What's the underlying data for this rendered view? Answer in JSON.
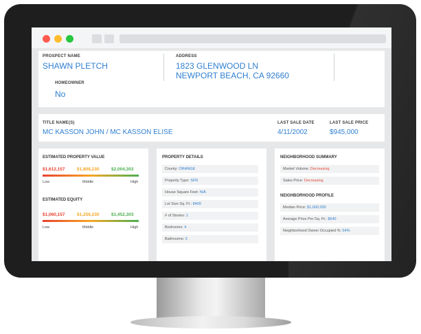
{
  "prospect": {
    "label": "PROSPECT NAME",
    "value": "SHAWN PLETCH"
  },
  "address": {
    "label": "ADDRESS",
    "line1": "1823 GLENWOOD LN",
    "line2": "NEWPORT BEACH, CA 92660"
  },
  "homeowner": {
    "label": "HOMEOWNER",
    "value": "No"
  },
  "title": {
    "label": "TITLE NAME(S)",
    "value": "MC KASSON JOHN / MC KASSON ELISE"
  },
  "last_sale_date": {
    "label": "LAST SALE DATE",
    "value": "4/11/2002"
  },
  "last_sale_price": {
    "label": "LAST SALE PRICE",
    "value": "$945,000"
  },
  "est_value": {
    "label": "ESTIMATED PROPERTY VALUE",
    "low": "$1,612,157",
    "mid": "$1,808,230",
    "high": "$2,004,303",
    "scale": [
      "Low",
      "Middle",
      "High"
    ]
  },
  "est_equity": {
    "label": "ESTIMATED EQUITY",
    "low": "$1,060,157",
    "mid": "$1,256,230",
    "high": "$1,452,303",
    "scale": [
      "Low",
      "Middle",
      "High"
    ]
  },
  "property_details": {
    "label": "PROPERTY DETAILS",
    "rows": [
      {
        "k": "County:",
        "v": "ORANGE"
      },
      {
        "k": "Property Type:",
        "v": "SFR"
      },
      {
        "k": "House Square Feet:",
        "v": "N/A"
      },
      {
        "k": "Lot Size Sq. Ft.:",
        "v": "8400"
      },
      {
        "k": "# of Stories:",
        "v": "1"
      },
      {
        "k": "Bedrooms:",
        "v": "4"
      },
      {
        "k": "Bathrooms:",
        "v": "3"
      }
    ]
  },
  "neighborhood_summary": {
    "label": "NEIGHBORHOOD SUMMARY",
    "rows": [
      {
        "k": "Market Volume:",
        "v": "Decreasing"
      },
      {
        "k": "Sales Price:",
        "v": "Decreasing"
      }
    ]
  },
  "neighborhood_profile": {
    "label": "NEIGHBORHOOD PROFILE",
    "rows": [
      {
        "k": "Median Price:",
        "v": "$1,600,000"
      },
      {
        "k": "Average Price Per Sq. Ft.:",
        "v": "$640"
      },
      {
        "k": "Neighborhood Owner Occupied %:",
        "v": "54%"
      }
    ]
  },
  "colors": {
    "accent": "#2f7fd1",
    "low": "#e8412e",
    "mid": "#f6a623",
    "high": "#4caf50"
  }
}
